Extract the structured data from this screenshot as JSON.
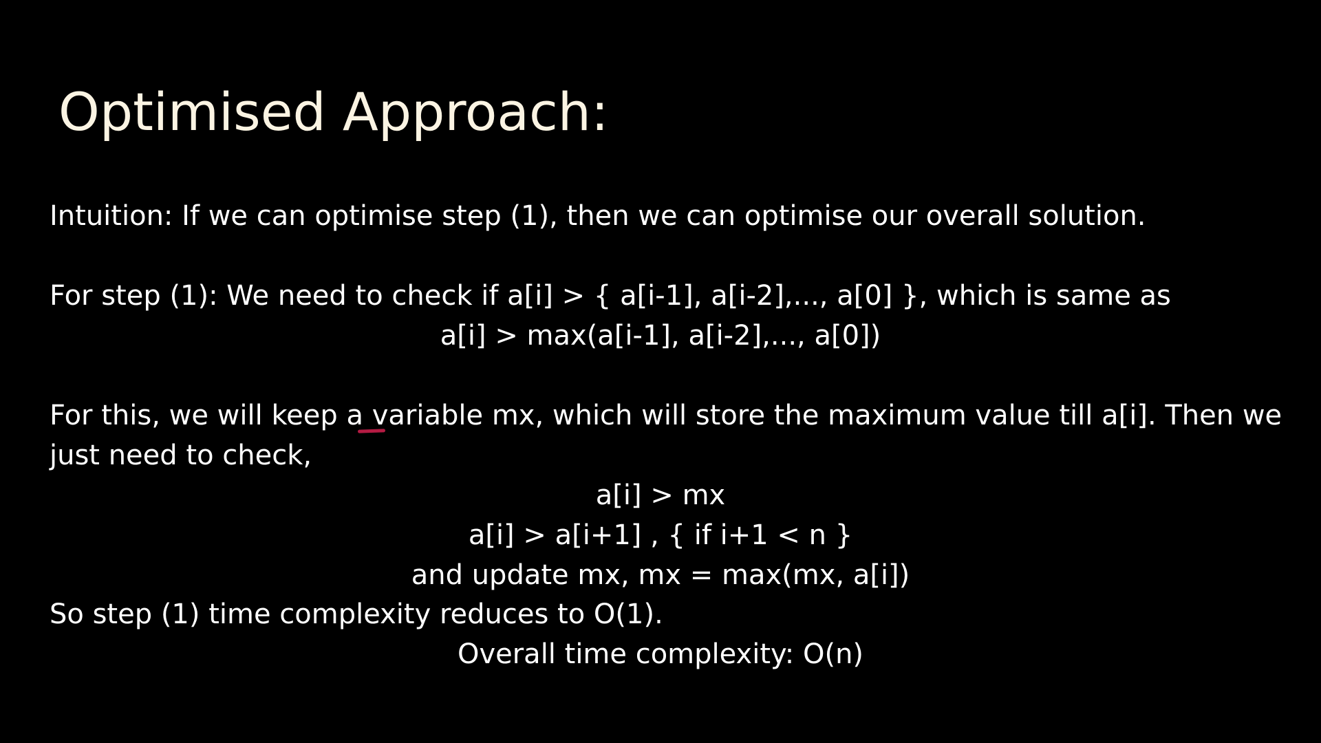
{
  "slide": {
    "title": "Optimised Approach:",
    "intuition": "Intuition: If we can optimise step (1), then we can optimise our overall solution.",
    "step_line": "For step (1): We need to check if a[i] > { a[i-1], a[i-2],..., a[0] }, which is same as",
    "step_formula": "a[i] > max(a[i-1], a[i-2],..., a[0])",
    "variable_line1": "For this, we will keep a variable mx, which will store the maximum value till a[i]. Then we",
    "variable_line2": "just need to check,",
    "check1": "a[i] > mx",
    "check2": "a[i] > a[i+1] , { if  i+1 < n }",
    "update": "and update mx,  mx = max(mx, a[i])",
    "step_complexity": "So step (1) time complexity reduces to O(1).",
    "overall_complexity": "Overall time complexity: O(n)"
  },
  "colors": {
    "background": "#000000",
    "title": "#fbf4e3",
    "text": "#ffffff",
    "annotation_mark": "#c81e4a"
  }
}
